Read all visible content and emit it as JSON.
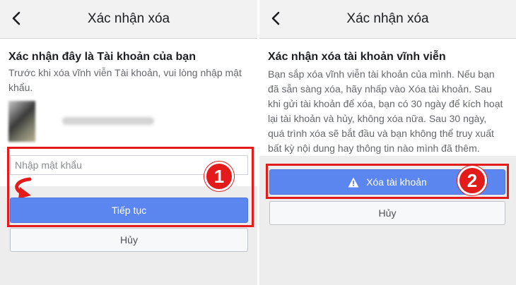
{
  "left": {
    "header": {
      "title": "Xác nhận xóa"
    },
    "heading": "Xác nhận đây là Tài khoản của bạn",
    "description": "Trước khi xóa vĩnh viễn Tài khoản, vui lòng nhập mật khẩu.",
    "password_input": {
      "value": "",
      "placeholder": "Nhập mật khẩu"
    },
    "continue_label": "Tiếp tục",
    "cancel_label": "Hủy",
    "step_number": "1"
  },
  "right": {
    "header": {
      "title": "Xác nhận xóa"
    },
    "heading": "Xác nhận xóa tài khoản vĩnh viễn",
    "description": "Bạn sắp xóa vĩnh viễn tài khoản của mình. Nếu bạn đã sẵn sàng xóa, hãy nhấp vào Xóa tài khoản. Sau khi gửi tài khoản để xóa, bạn có 30 ngày để kích hoạt lại tài khoản và hủy, không xóa nữa. Sau 30 ngày, quá trình xóa sẽ bắt đầu và bạn không thể truy xuất bất kỳ nội dung hay thông tin nào mình đã thêm.",
    "delete_label": "Xóa tài khoản",
    "cancel_label": "Hủy",
    "step_number": "2"
  },
  "icons": {
    "back": "chevron-left-icon",
    "warning": "warning-triangle-icon",
    "hint_arrow": "curved-arrow-icon"
  },
  "colors": {
    "primary_button": "#5b86f0",
    "highlight": "#e31b1b",
    "background": "#ededed"
  }
}
